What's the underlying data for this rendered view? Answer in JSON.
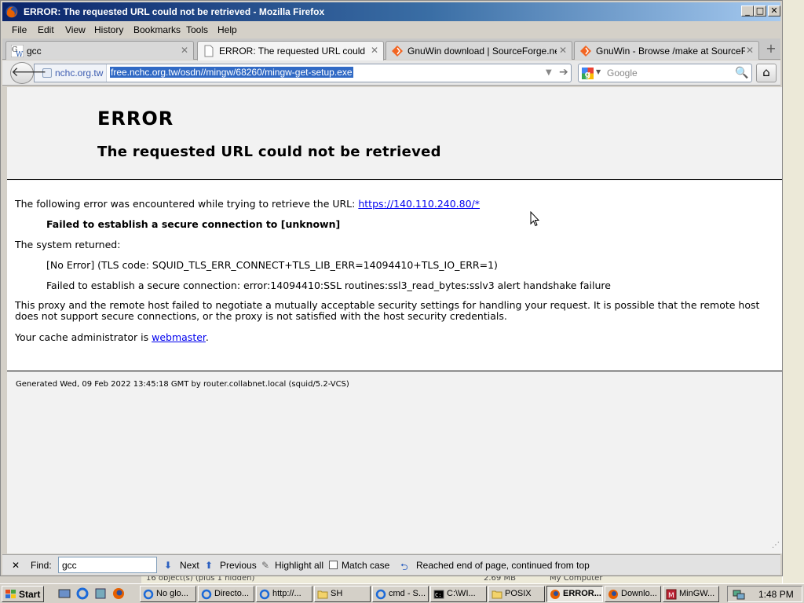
{
  "window": {
    "title": "ERROR: The requested URL could not be retrieved - Mozilla Firefox",
    "min": "_",
    "max": "□",
    "close": "✕"
  },
  "menu": [
    "File",
    "Edit",
    "View",
    "History",
    "Bookmarks",
    "Tools",
    "Help"
  ],
  "tabs": [
    {
      "label": "gcc",
      "icon": "gnuwin-icon"
    },
    {
      "label": "ERROR: The requested URL could not ...",
      "icon": "blank-page-icon"
    },
    {
      "label": "GnuWin download | SourceForge.net",
      "icon": "sourceforge-icon"
    },
    {
      "label": "GnuWin - Browse /make at SourceForg...",
      "icon": "sourceforge-icon"
    }
  ],
  "tab_close": "✕",
  "new_tab": "+",
  "nav": {
    "back": "🡐",
    "site": "nchc.org.tw",
    "url": "free.nchc.org.tw/osdn//mingw/68260/mingw-get-setup.exe",
    "url_dropdown": "▼",
    "go": "➔",
    "search_placeholder": "Google",
    "search_dropdown": "▼",
    "search_icon": "🔍",
    "home": "⌂"
  },
  "page": {
    "h1": "ERROR",
    "h2": "The requested URL could not be retrieved",
    "intro": "The following error was encountered while trying to retrieve the URL: ",
    "intro_link": "https://140.110.240.80/*",
    "failure": "Failed to establish a secure connection to [unknown]",
    "system_returned": "The system returned:",
    "tls_code": "[No Error] (TLS code: SQUID_TLS_ERR_CONNECT+TLS_LIB_ERR=14094410+TLS_IO_ERR=1)",
    "ssl_error": "Failed to establish a secure connection: error:14094410:SSL routines:ssl3_read_bytes:sslv3 alert handshake failure",
    "explanation": "This proxy and the remote host failed to negotiate a mutually acceptable security settings for handling your request. It is possible that the remote host does not support secure connections, or the proxy is not satisfied with the host security credentials.",
    "admin_prefix": "Your cache administrator is ",
    "admin_link": "webmaster",
    "admin_suffix": ".",
    "footer": "Generated Wed, 09 Feb 2022 13:45:18 GMT by router.collabnet.local (squid/5.2-VCS)"
  },
  "findbar": {
    "close": "✕",
    "label": "Find:",
    "value": "gcc",
    "next": "Next",
    "previous": "Previous",
    "highlight": "Highlight all",
    "match_case": "Match case",
    "status": "Reached end of page, continued from top"
  },
  "behind_status": {
    "objects": "16 object(s) (plus 1 hidden)",
    "size": "2.69 MB",
    "location": "My Computer"
  },
  "taskbar": {
    "start": "Start",
    "tasks": [
      {
        "label": "No glo...",
        "icon": "ie-icon"
      },
      {
        "label": "Directo...",
        "icon": "ie-icon"
      },
      {
        "label": "http://...",
        "icon": "ie-icon"
      },
      {
        "label": "SH",
        "icon": "folder-icon"
      },
      {
        "label": "cmd - S...",
        "icon": "ie-icon"
      },
      {
        "label": "C:\\WI...",
        "icon": "cmd-icon"
      },
      {
        "label": "POSIX",
        "icon": "folder-icon"
      },
      {
        "label": "ERROR...",
        "icon": "firefox-icon"
      },
      {
        "label": "Downlo...",
        "icon": "firefox-icon"
      },
      {
        "label": "MinGW...",
        "icon": "app-icon"
      }
    ],
    "clock": "1:48 PM"
  },
  "colors": {
    "title_gradient_start": "#0a246a",
    "link": "#0000ee",
    "url_selection": "#316ac5"
  }
}
